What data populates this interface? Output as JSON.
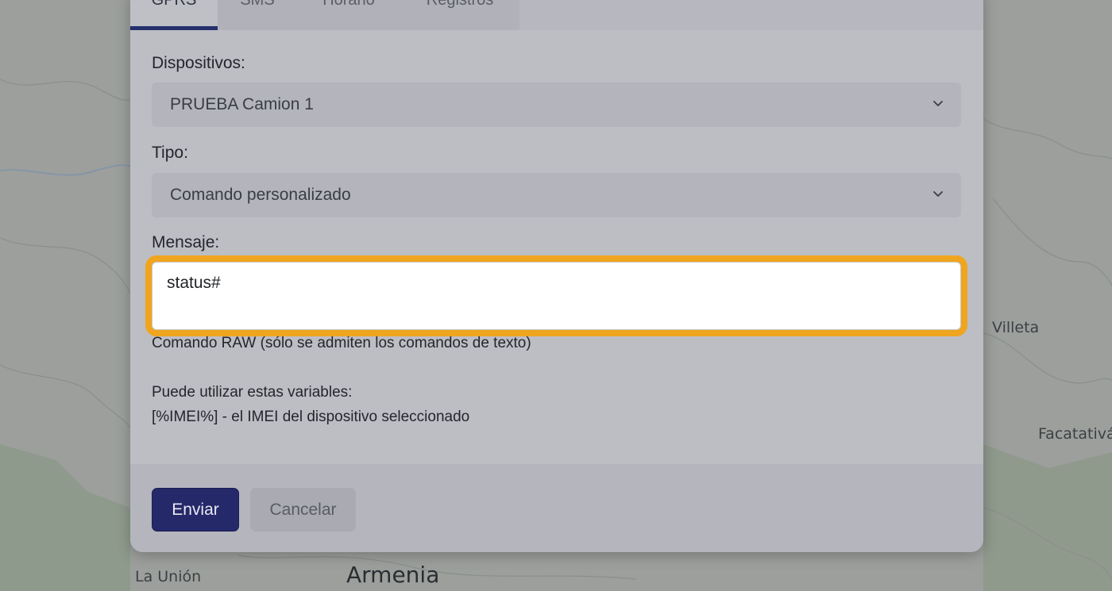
{
  "map": {
    "labels": {
      "villeta": "Villeta",
      "facatativa": "Facatativá",
      "la_union": "La Unión",
      "armenia": "Armenia"
    }
  },
  "modal": {
    "tabs": [
      {
        "label": "GPRS",
        "active": true
      },
      {
        "label": "SMS",
        "active": false
      },
      {
        "label": "Horario",
        "active": false
      },
      {
        "label": "Registros",
        "active": false
      }
    ],
    "fields": {
      "devices_label": "Dispositivos:",
      "devices_value": "PRUEBA Camion 1",
      "type_label": "Tipo:",
      "type_value": "Comando personalizado",
      "message_label": "Mensaje:",
      "message_value": "status#"
    },
    "help": {
      "raw": "Comando RAW (sólo se admiten los comandos de texto)",
      "vars": "Puede utilizar estas variables:",
      "imei": "[%IMEI%] - el IMEI del dispositivo seleccionado"
    },
    "buttons": {
      "send": "Enviar",
      "cancel": "Cancelar"
    }
  },
  "colors": {
    "accent": "#25296a",
    "focus": "#efa51f",
    "tab_underline": "#25306b"
  }
}
